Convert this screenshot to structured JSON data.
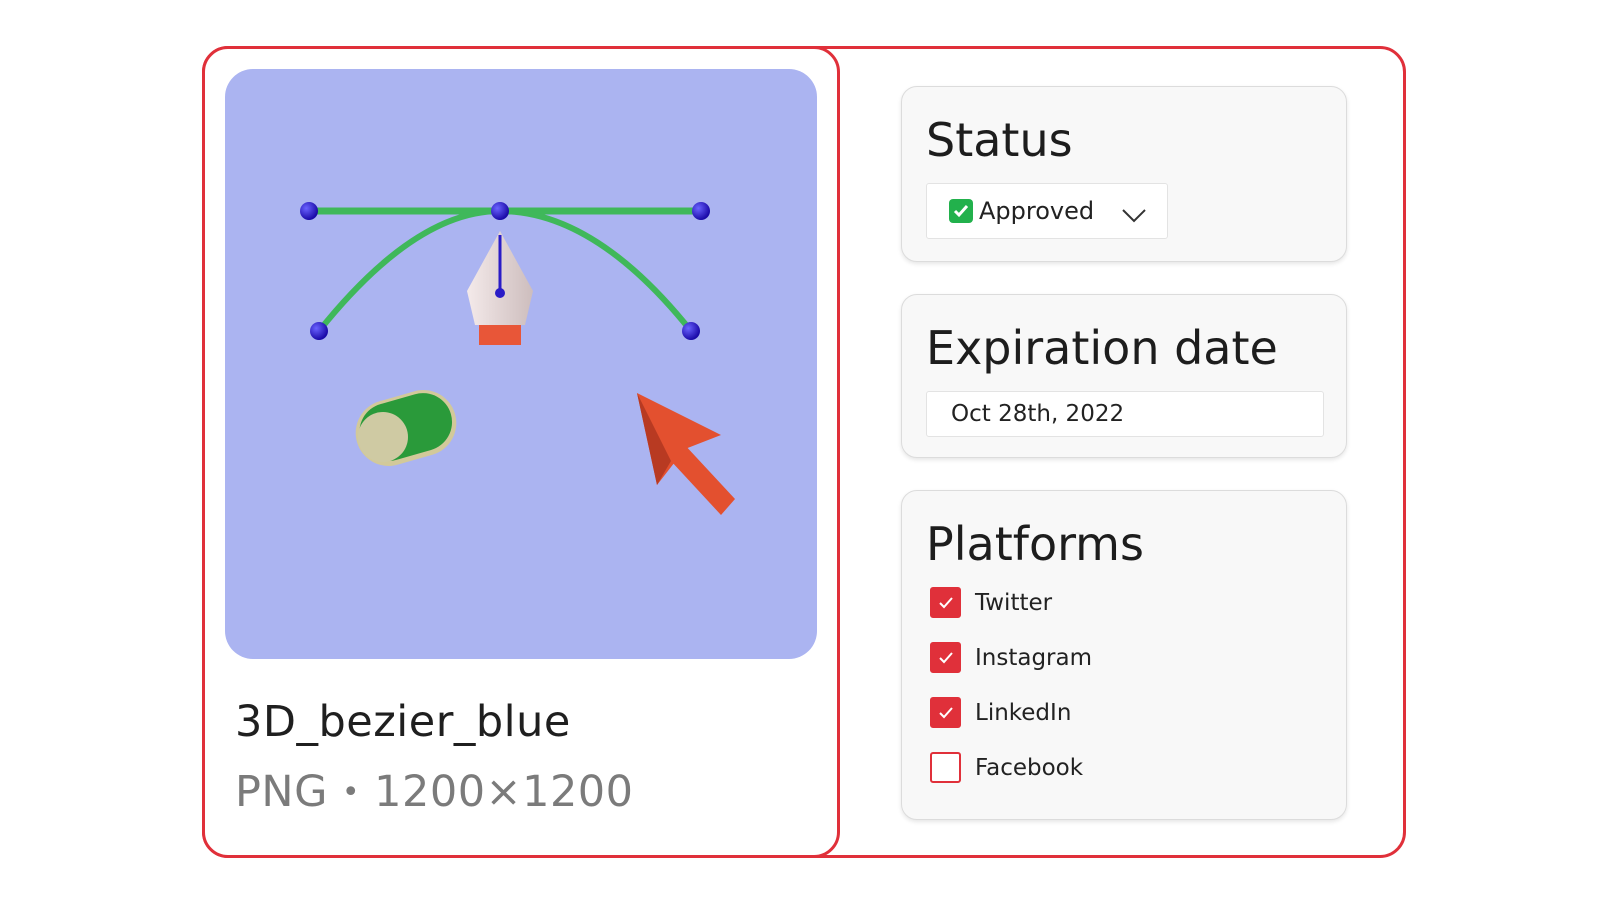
{
  "asset": {
    "name": "3D_bezier_blue",
    "format": "PNG",
    "separator": "•",
    "dimensions": "1200×1200",
    "preview_background": "#abb4f1"
  },
  "status": {
    "title": "Status",
    "selected_value": "Approved",
    "icon": "check-mark-emoji-icon"
  },
  "expiration": {
    "title": "Expiration date",
    "value": "Oct 28th, 2022"
  },
  "platforms": {
    "title": "Platforms",
    "items": [
      {
        "label": "Twitter",
        "checked": true
      },
      {
        "label": "Instagram",
        "checked": true
      },
      {
        "label": "LinkedIn",
        "checked": true
      },
      {
        "label": "Facebook",
        "checked": false
      }
    ]
  },
  "colors": {
    "accent": "#e0303a",
    "panel_bg": "#f8f8f8"
  }
}
